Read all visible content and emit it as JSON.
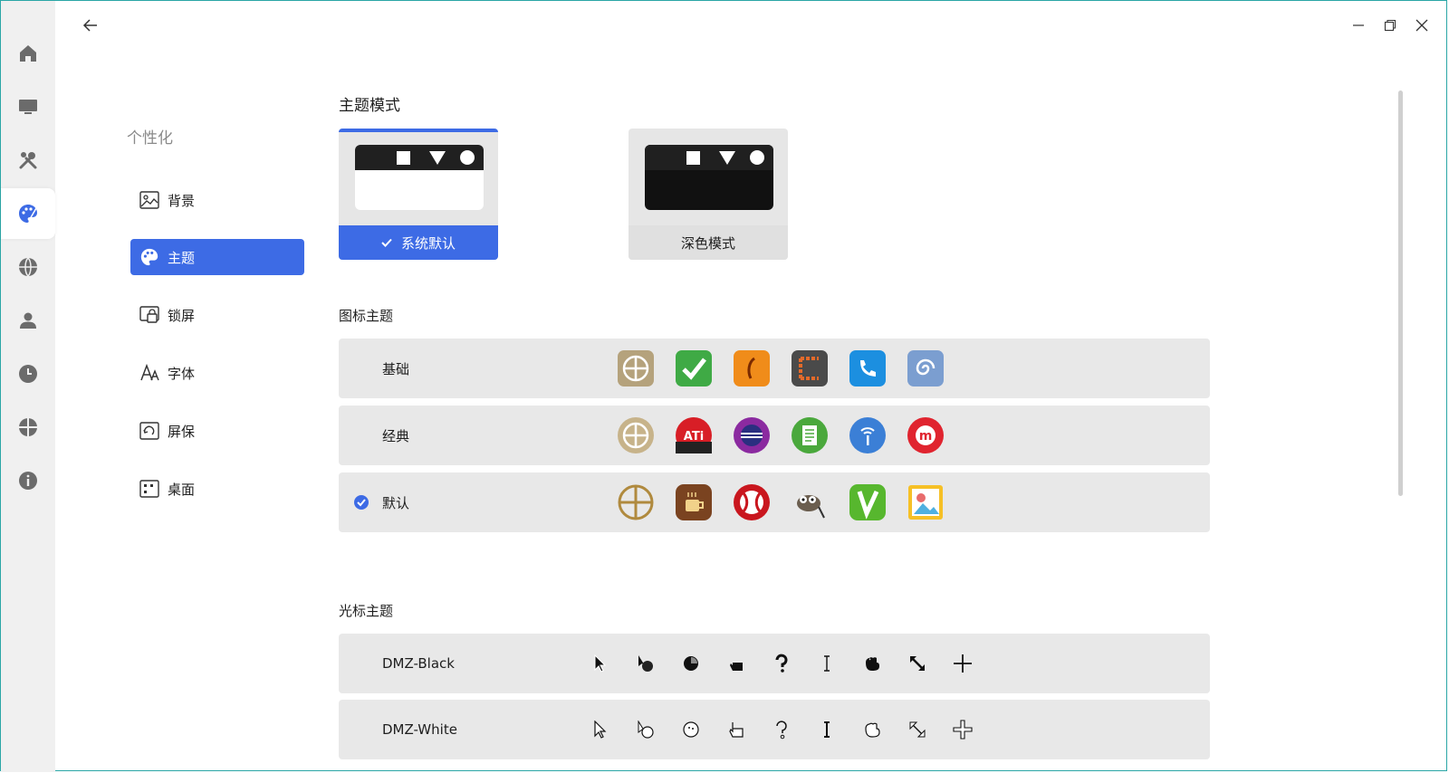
{
  "window": {
    "back_icon": "arrow-left-icon",
    "controls": [
      "minimize-icon",
      "restore-icon",
      "close-icon"
    ]
  },
  "rail": {
    "items": [
      "home-icon",
      "display-icon",
      "tools-icon",
      "palette-icon",
      "globe-icon",
      "user-icon",
      "clock-icon",
      "network-icon",
      "info-icon"
    ],
    "active_index": 3
  },
  "nav": {
    "title": "个性化",
    "items": [
      {
        "label": "背景",
        "icon": "image-icon"
      },
      {
        "label": "主题",
        "icon": "palette-icon"
      },
      {
        "label": "锁屏",
        "icon": "lockscreen-icon"
      },
      {
        "label": "字体",
        "icon": "font-icon"
      },
      {
        "label": "屏保",
        "icon": "screensaver-icon"
      },
      {
        "label": "桌面",
        "icon": "desktop-grid-icon"
      }
    ],
    "active_index": 1
  },
  "theme_mode": {
    "title": "主题模式",
    "options": [
      {
        "label": "系统默认",
        "selected": true
      },
      {
        "label": "深色模式",
        "selected": false
      }
    ],
    "accent": "#3d6be5"
  },
  "icon_theme": {
    "title": "图标主题",
    "rows": [
      {
        "name": "基础",
        "selected": false,
        "icons": [
          "crosshair-app-icon",
          "checkmark-app-icon",
          "phone-orange-app-icon",
          "frame-app-icon",
          "phone-blue-app-icon",
          "swirl-app-icon"
        ]
      },
      {
        "name": "经典",
        "selected": false,
        "icons": [
          "crosshair-app-icon",
          "ati-app-icon",
          "eclipse-app-icon",
          "document-app-icon",
          "signal-app-icon",
          "m-app-icon"
        ]
      },
      {
        "name": "默认",
        "selected": true,
        "icons": [
          "crosshair-app-icon",
          "coffee-app-icon",
          "baseball-app-icon",
          "gimp-app-icon",
          "vim-app-icon",
          "image-viewer-app-icon"
        ]
      }
    ],
    "ati_label": "ATi",
    "m_label": "m"
  },
  "cursor_theme": {
    "title": "光标主题",
    "rows": [
      {
        "name": "DMZ-Black",
        "cursors": [
          "arrow-cursor-icon",
          "busy-arrow-cursor-icon",
          "wait-cursor-icon",
          "hand-cursor-icon",
          "help-cursor-icon",
          "text-cursor-icon",
          "grab-cursor-icon",
          "resize-cursor-icon",
          "crosshair-cursor-icon"
        ]
      },
      {
        "name": "DMZ-White",
        "cursors": [
          "arrow-cursor-icon",
          "busy-arrow-cursor-icon",
          "wait-cursor-icon",
          "hand-cursor-icon",
          "help-cursor-icon",
          "text-cursor-icon",
          "grab-cursor-icon",
          "resize-cursor-icon",
          "crosshair-cursor-icon"
        ]
      }
    ]
  }
}
